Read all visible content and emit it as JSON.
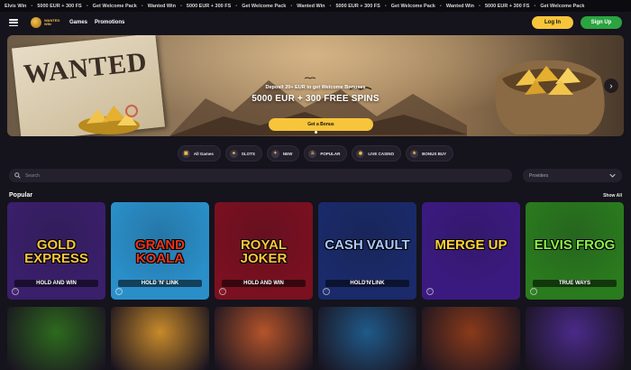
{
  "ticker": [
    "Elvis Win",
    "5000 EUR + 300 FS",
    "Get Welcome Pack",
    "Wanted Win",
    "5000 EUR + 300 FS",
    "Get Welcome Pack",
    "Wanted Win",
    "5000 EUR + 300 FS",
    "Get Welcome Pack",
    "Wanted Win",
    "5000 EUR + 300 FS",
    "Get Welcome Pack"
  ],
  "header": {
    "logo_text": "WANTED WIN",
    "nav": [
      "Games",
      "Promotions"
    ],
    "login": "Log In",
    "signup": "Sign Up"
  },
  "hero": {
    "poster_text": "WANTED",
    "subtitle": "Deposit 20+ EUR to get Welcome Bonuses",
    "title": "5000 EUR + 300 FREE SPINS",
    "cta": "Get a Bonus",
    "arrow": "›"
  },
  "categories": [
    {
      "label": "All Games",
      "icon": "grid-icon",
      "glyph": "▦"
    },
    {
      "label": "SLOTS",
      "icon": "slots-icon",
      "glyph": "♣"
    },
    {
      "label": "NEW",
      "icon": "new-icon",
      "glyph": "✦"
    },
    {
      "label": "POPULAR",
      "icon": "fire-icon",
      "glyph": "♨"
    },
    {
      "label": "LIVE CASINO",
      "icon": "live-icon",
      "glyph": "◉"
    },
    {
      "label": "BONUS BUY",
      "icon": "bonus-icon",
      "glyph": "★"
    }
  ],
  "search": {
    "placeholder": "Search"
  },
  "providers": {
    "label": "Providers"
  },
  "popular": {
    "title": "Popular",
    "view_all": "Show All",
    "games": [
      {
        "name": "GOLD EXPRESS",
        "sub": "HOLD AND WIN",
        "bg": "#3a1f6b",
        "color": "#f7c53b"
      },
      {
        "name": "GRAND KOALA",
        "sub": "HOLD 'N' LINK",
        "bg": "#2a8fc9",
        "color": "#e8341d"
      },
      {
        "name": "ROYAL JOKER",
        "sub": "HOLD AND WIN",
        "bg": "#7a1020",
        "color": "#f7c53b"
      },
      {
        "name": "CASH VAULT",
        "sub": "HOLD'N'LINK",
        "bg": "#1a2a6a",
        "color": "#a9c8ff"
      },
      {
        "name": "MERGE UP",
        "sub": "",
        "bg": "#3b1a80",
        "color": "#ffd23a"
      },
      {
        "name": "ELVIS FROG",
        "sub": "TRUE WAYS",
        "bg": "#2a7a1e",
        "color": "#8bf04a"
      }
    ],
    "row2": [
      {
        "bg": "#2d6a1e"
      },
      {
        "bg": "#c88a2a"
      },
      {
        "bg": "#b4542a"
      },
      {
        "bg": "#1f5a8a"
      },
      {
        "bg": "#8a3a1a"
      },
      {
        "bg": "#4a2a8a"
      }
    ]
  }
}
